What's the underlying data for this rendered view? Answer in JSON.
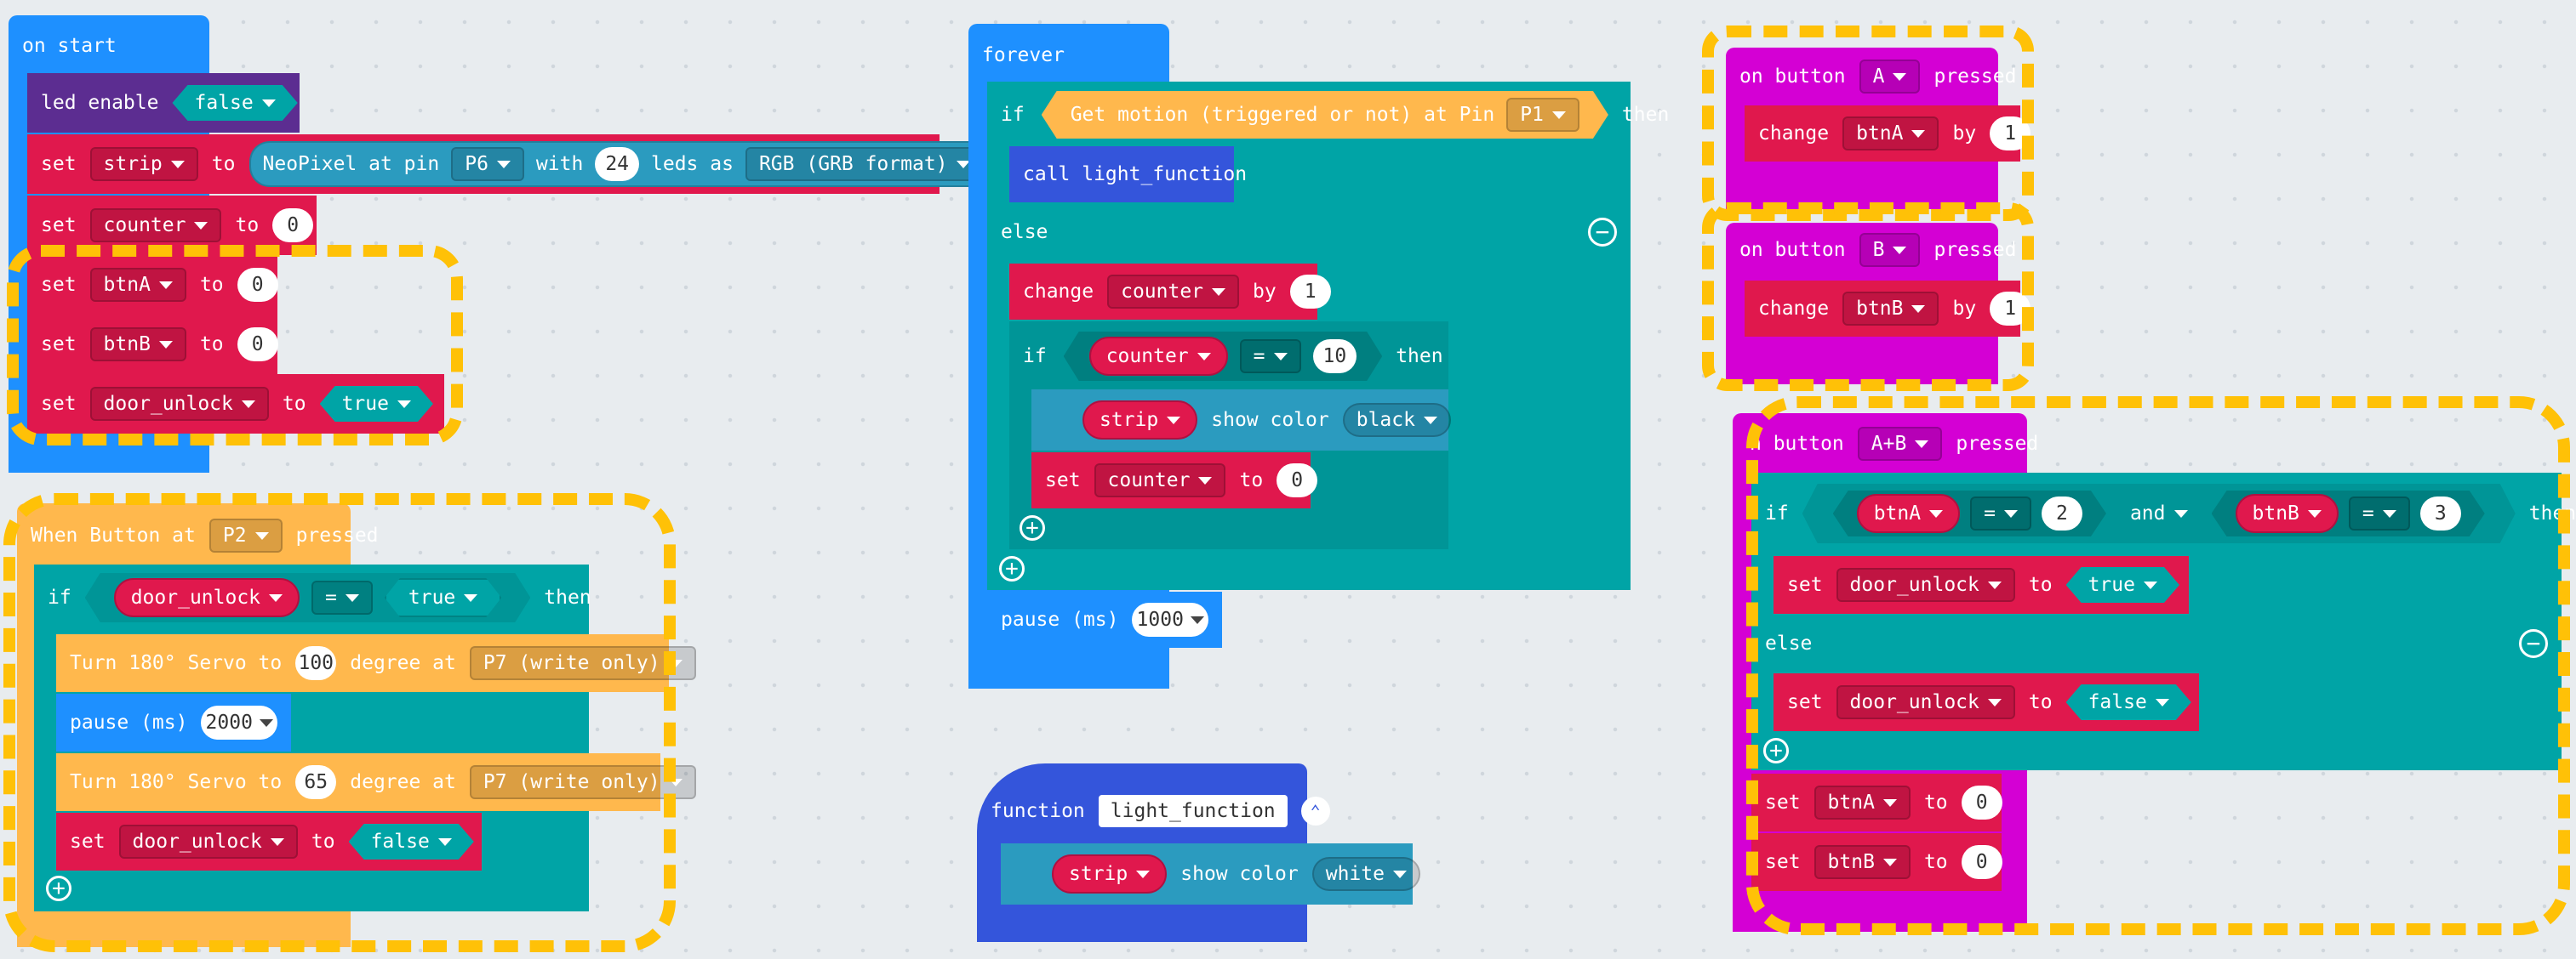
{
  "on_start": {
    "hat": "on start",
    "led_enable": {
      "label": "led enable",
      "value": "false"
    },
    "set_strip": {
      "set": "set",
      "var": "strip",
      "to": "to",
      "neopixel": "NeoPixel at pin",
      "pin": "P6",
      "with": "with",
      "leds": "24",
      "leds_as": "leds as",
      "format": "RGB (GRB format)"
    },
    "set_counter": {
      "set": "set",
      "var": "counter",
      "to": "to",
      "value": "0"
    },
    "set_btnA": {
      "set": "set",
      "var": "btnA",
      "to": "to",
      "value": "0"
    },
    "set_btnB": {
      "set": "set",
      "var": "btnB",
      "to": "to",
      "value": "0"
    },
    "set_door": {
      "set": "set",
      "var": "door_unlock",
      "to": "to",
      "value": "true"
    }
  },
  "button_p2": {
    "hat": {
      "when": "When Button at",
      "pin": "P2",
      "pressed": "pressed"
    },
    "if": "if",
    "var": "door_unlock",
    "op": "=",
    "value": "true",
    "then": "then",
    "servo1": {
      "label": "Turn 180° Servo to",
      "deg": "100",
      "at": "degree at",
      "pin": "P7 (write only)"
    },
    "pause": {
      "label": "pause (ms)",
      "value": "2000"
    },
    "servo2": {
      "label": "Turn 180° Servo to",
      "deg": "65",
      "at": "degree at",
      "pin": "P7 (write only)"
    },
    "set_door": {
      "set": "set",
      "var": "door_unlock",
      "to": "to",
      "value": "false"
    }
  },
  "forever": {
    "hat": "forever",
    "if": "if",
    "motion": {
      "label": "Get motion (triggered or not) at Pin",
      "pin": "P1"
    },
    "then": "then",
    "call": "call light_function",
    "else": "else",
    "change": {
      "change": "change",
      "var": "counter",
      "by": "by",
      "value": "1"
    },
    "inner_if": {
      "if": "if",
      "var": "counter",
      "op": "=",
      "value": "10",
      "then": "then"
    },
    "strip_show": {
      "var": "strip",
      "label": "show color",
      "color": "black"
    },
    "set_counter": {
      "set": "set",
      "var": "counter",
      "to": "to",
      "value": "0"
    },
    "pause": {
      "label": "pause (ms)",
      "value": "1000"
    }
  },
  "function": {
    "label": "function",
    "name": "light_function",
    "strip_show": {
      "var": "strip",
      "label": "show color",
      "color": "white"
    }
  },
  "button_a": {
    "on": "on button",
    "btn": "A",
    "pressed": "pressed",
    "change": "change",
    "var": "btnA",
    "by": "by",
    "value": "1"
  },
  "button_b": {
    "on": "on button",
    "btn": "B",
    "pressed": "pressed",
    "change": "change",
    "var": "btnB",
    "by": "by",
    "value": "1"
  },
  "button_ab": {
    "on": "n button",
    "btn": "A+B",
    "pressed": "pressed",
    "if": "if",
    "var1": "btnA",
    "op1": "=",
    "val1": "2",
    "and": "and",
    "var2": "btnB",
    "op2": "=",
    "val2": "3",
    "then": "then",
    "set_true": {
      "set": "set",
      "var": "door_unlock",
      "to": "to",
      "value": "true"
    },
    "else": "else",
    "set_false": {
      "set": "set",
      "var": "door_unlock",
      "to": "to",
      "value": "false"
    },
    "set_btnA": {
      "set": "set",
      "var": "btnA",
      "to": "to",
      "value": "0"
    },
    "set_btnB": {
      "set": "set",
      "var": "btnB",
      "to": "to",
      "value": "0"
    }
  },
  "colors": {
    "base": "#1e90ff",
    "variables": "#e0184d",
    "logic": "#00a4a6",
    "neopixel": "#2b9bbf",
    "servo": "#ffb84d",
    "input": "#d400d4",
    "functions": "#3455db",
    "led": "#5c2d91",
    "highlight": "#ffc107"
  }
}
